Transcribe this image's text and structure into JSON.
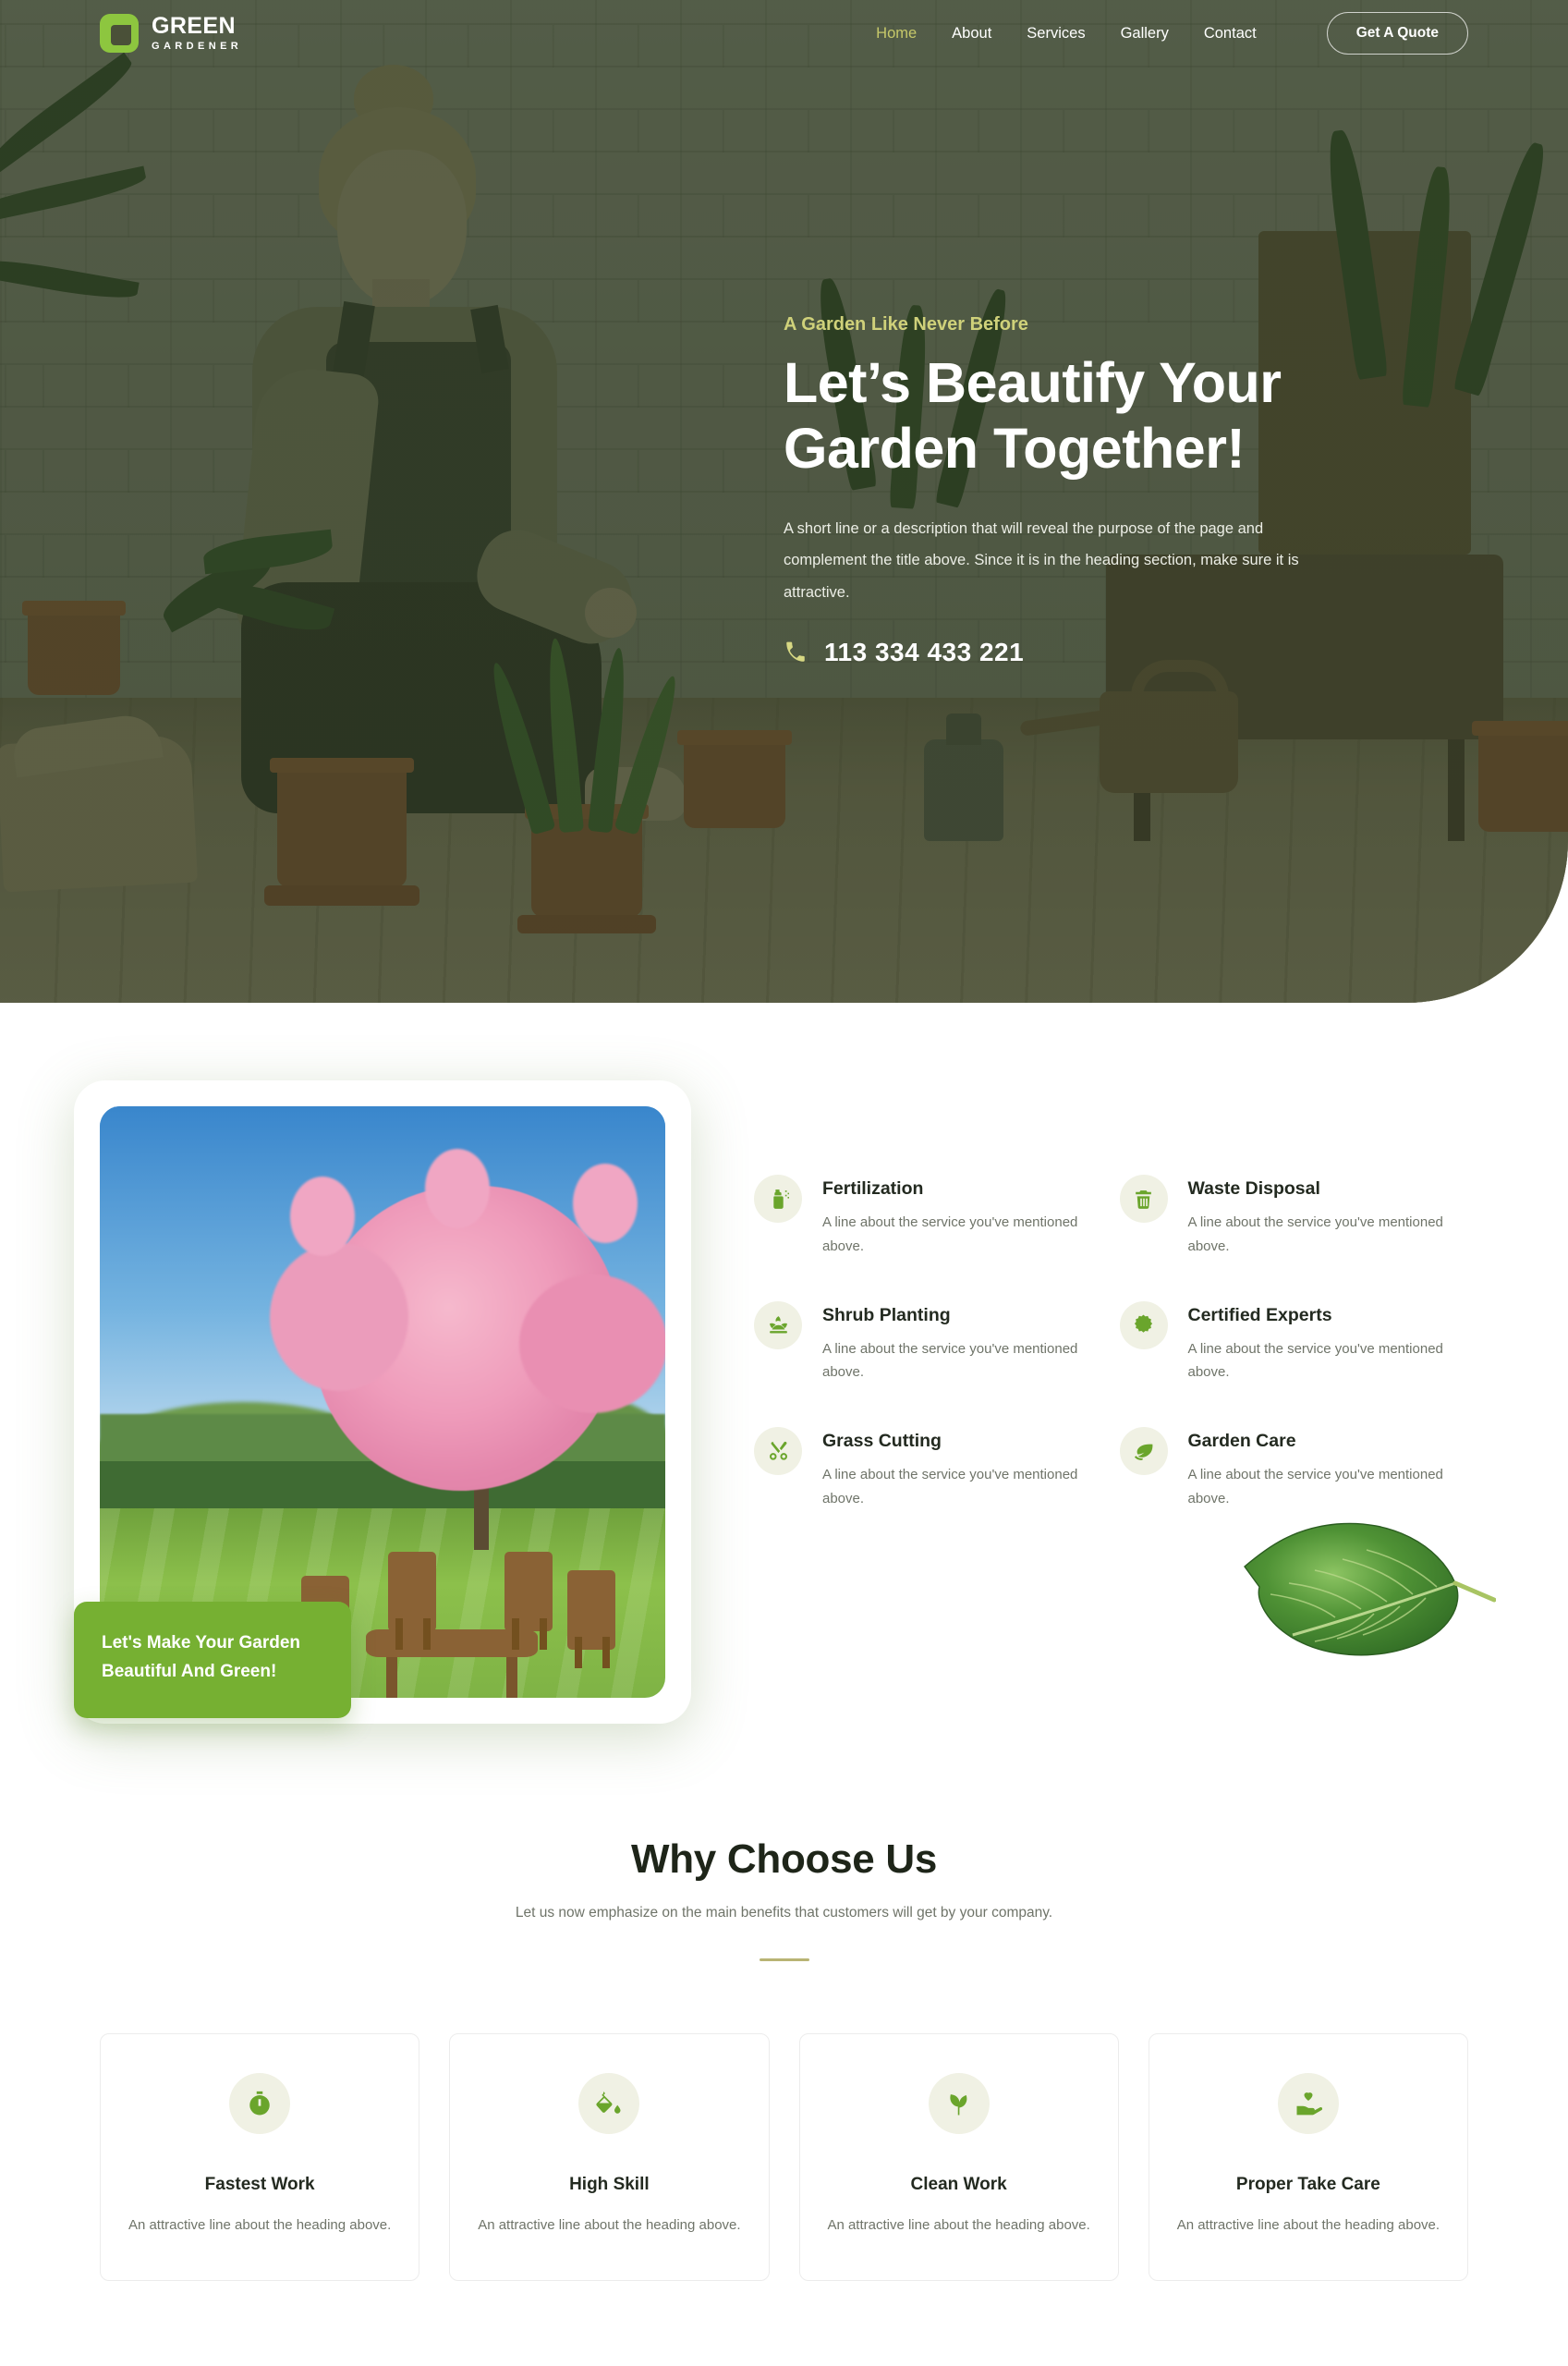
{
  "brand": {
    "name": "GREEN",
    "sub": "GARDENER",
    "mark_icon": "leaf-logo-icon",
    "color": "#8dc63f"
  },
  "nav": {
    "items": [
      {
        "label": "Home",
        "active": true
      },
      {
        "label": "About",
        "active": false
      },
      {
        "label": "Services",
        "active": false
      },
      {
        "label": "Gallery",
        "active": false
      },
      {
        "label": "Contact",
        "active": false
      }
    ],
    "cta_label": "Get A Quote",
    "active_color": "#c6c86a"
  },
  "hero": {
    "eyebrow": "A Garden Like Never Before",
    "title_line1": "Let’s Beautify Your",
    "title_line2": "Garden Together!",
    "description": "A short line or a description that will reveal the purpose of the page and complement the title above. Since it is in the heading section, make sure it is attractive.",
    "phone_icon": "phone-icon",
    "phone": "113 334 433 221",
    "eyebrow_color": "#cfd17a"
  },
  "about": {
    "image_caption": "Let's Make Your Garden Beautiful And Green!",
    "badge_color": "#76b032",
    "leaf_decoration_icon": "leaf-photo-icon",
    "services": [
      {
        "icon": "fertilizer-spray-icon",
        "title": "Fertilization",
        "desc": "A line about the service you've mentioned above."
      },
      {
        "icon": "trash-bin-icon",
        "title": "Waste Disposal",
        "desc": "A line about the service you've mentioned above."
      },
      {
        "icon": "shrub-sprout-icon",
        "title": "Shrub Planting",
        "desc": "A line about the service you've mentioned above."
      },
      {
        "icon": "certificate-badge-icon",
        "title": "Certified Experts",
        "desc": "A line about the service you've mentioned above."
      },
      {
        "icon": "scissors-icon",
        "title": "Grass Cutting",
        "desc": "A line about the service you've mentioned above."
      },
      {
        "icon": "leaf-icon",
        "title": "Garden Care",
        "desc": "A line about the service you've mentioned above."
      }
    ]
  },
  "why": {
    "title": "Why Choose Us",
    "subtitle": "Let us now emphasize on the main benefits that customers will get by your company.",
    "rule_color": "#b9b474",
    "features": [
      {
        "icon": "stopwatch-icon",
        "title": "Fastest Work",
        "desc": "An attractive line about the heading above."
      },
      {
        "icon": "paint-bucket-icon",
        "title": "High Skill",
        "desc": "An attractive line about the heading above."
      },
      {
        "icon": "seedling-icon",
        "title": "Clean Work",
        "desc": "An attractive line about the heading above."
      },
      {
        "icon": "hand-heart-icon",
        "title": "Proper Take Care",
        "desc": "An attractive line about the heading above."
      }
    ]
  }
}
